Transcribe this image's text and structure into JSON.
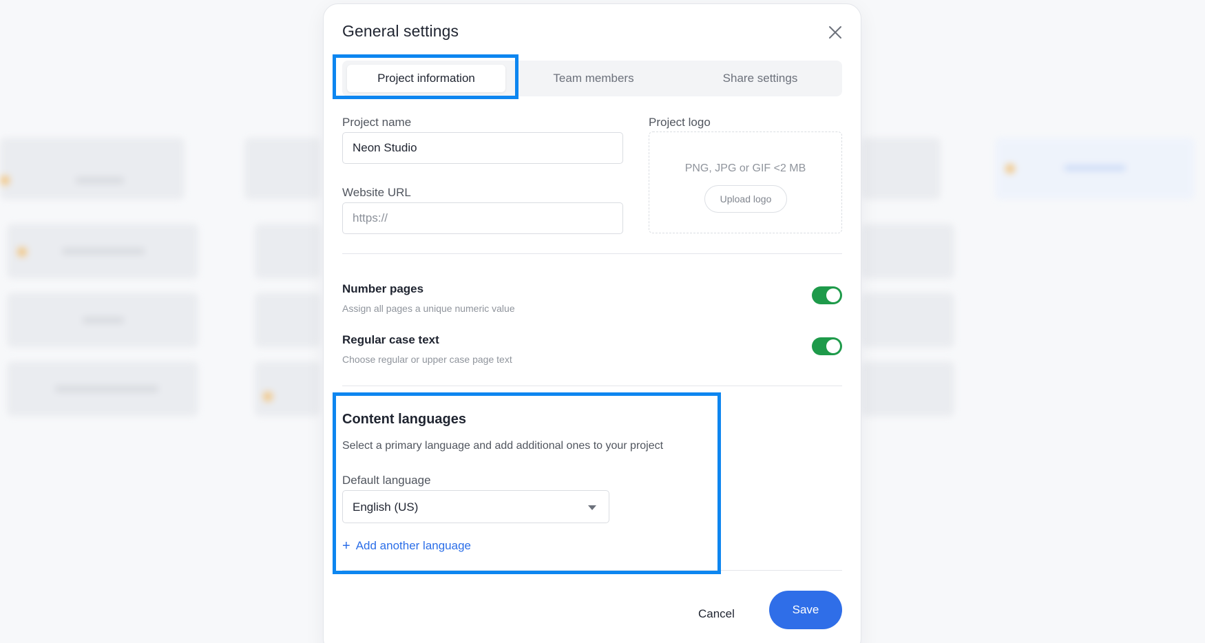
{
  "dialog": {
    "title": "General settings",
    "close_icon": "close-icon"
  },
  "tabs": [
    {
      "label": "Project information",
      "active": true
    },
    {
      "label": "Team members",
      "active": false
    },
    {
      "label": "Share settings",
      "active": false
    }
  ],
  "project_info": {
    "name_label": "Project name",
    "name_value": "Neon Studio",
    "url_label": "Website URL",
    "url_placeholder": "https://",
    "logo_label": "Project logo",
    "logo_hint": "PNG, JPG or GIF <2 MB",
    "upload_label": "Upload logo"
  },
  "options": [
    {
      "title": "Number pages",
      "subtitle": "Assign all pages a unique numeric value",
      "enabled": true
    },
    {
      "title": "Regular case text",
      "subtitle": "Choose regular or upper case page text",
      "enabled": true
    }
  ],
  "languages": {
    "title": "Content languages",
    "subtitle": "Select a primary language and add additional ones to your project",
    "default_label": "Default language",
    "default_value": "English (US)",
    "add_label": "Add another language",
    "add_icon": "plus-icon"
  },
  "footer": {
    "cancel_label": "Cancel",
    "save_label": "Save"
  },
  "colors": {
    "accent": "#2f6ee8",
    "toggle_on": "#1e9a4a",
    "highlight": "#0d86f0"
  }
}
